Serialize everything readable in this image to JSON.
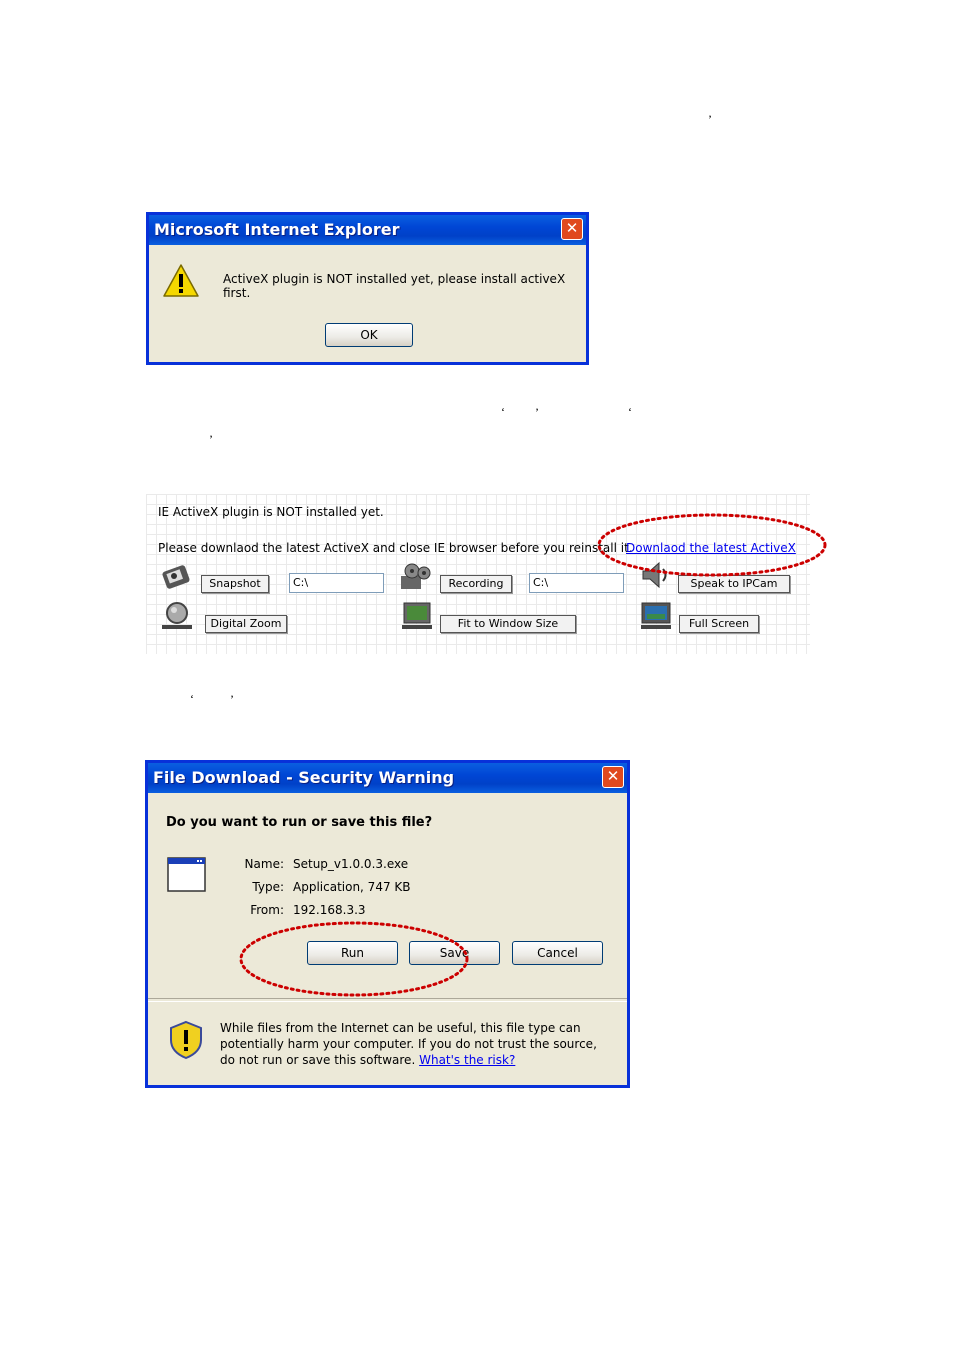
{
  "stray_marks": [
    "’",
    "‘",
    "’",
    "‘",
    "’",
    "‘",
    "’"
  ],
  "ie_dialog": {
    "title": "Microsoft Internet Explorer",
    "close_glyph": "✕",
    "message": "ActiveX plugin is NOT installed yet, please install activeX first.",
    "ok_label": "OK"
  },
  "activex_panel": {
    "status": "IE ActiveX plugin is NOT installed yet.",
    "instruction": "Please downlaod the latest ActiveX and close IE browser before you reinstall it.",
    "download_link": "Downlaod the latest ActiveX",
    "snapshot_label": "Snapshot",
    "snapshot_path": "C:\\",
    "recording_label": "Recording",
    "recording_path": "C:\\",
    "speak_label": "Speak to IPCam",
    "digital_zoom_label": "Digital Zoom",
    "fit_window_label": "Fit to Window Size",
    "full_screen_label": "Full Screen"
  },
  "file_download": {
    "title": "File Download - Security Warning",
    "close_glyph": "✕",
    "question": "Do you want to run or save this file?",
    "name_label": "Name:",
    "name_value": "Setup_v1.0.0.3.exe",
    "type_label": "Type:",
    "type_value": "Application, 747 KB",
    "from_label": "From:",
    "from_value": "192.168.3.3",
    "run_label": "Run",
    "save_label": "Save",
    "cancel_label": "Cancel",
    "warning_text": "While files from the Internet can be useful, this file type can potentially harm your computer. If you do not trust the source, do not run or save this software.",
    "risk_link": "What's the risk?"
  },
  "colors": {
    "title_bar": "#0046d5",
    "highlight_ellipse": "#cc0000",
    "link": "#0000ee"
  }
}
